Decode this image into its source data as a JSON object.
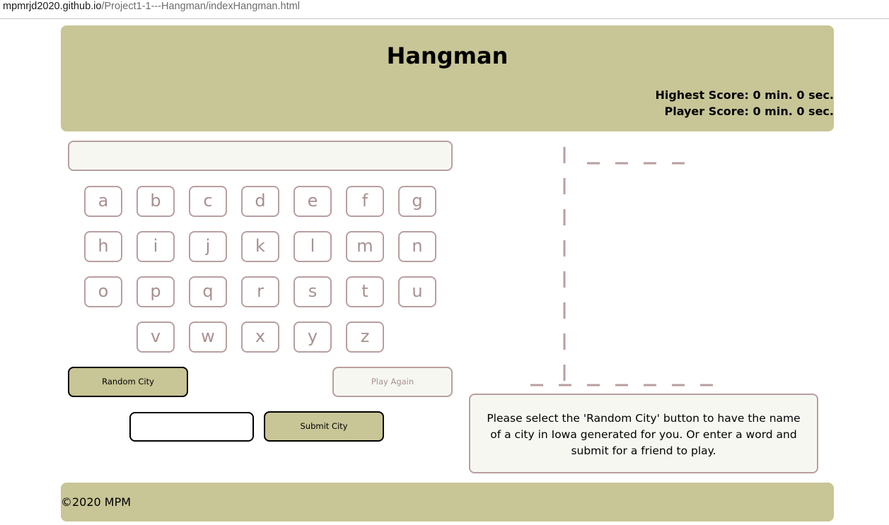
{
  "browser": {
    "url_host": "mpmrjd2020.github.io",
    "url_path": "/Project1-1---Hangman/indexHangman.html"
  },
  "header": {
    "title": "Hangman",
    "highest_score": "Highest Score: 0 min. 0 sec.",
    "player_score": "Player Score: 0 min. 0 sec."
  },
  "word_display": "",
  "keyboard": {
    "rows": [
      [
        "a",
        "b",
        "c",
        "d",
        "e",
        "f",
        "g"
      ],
      [
        "h",
        "i",
        "j",
        "k",
        "l",
        "m",
        "n"
      ],
      [
        "o",
        "p",
        "q",
        "r",
        "s",
        "t",
        "u"
      ],
      [
        "v",
        "w",
        "x",
        "y",
        "z"
      ]
    ]
  },
  "buttons": {
    "random_city": "Random City",
    "play_again": "Play Again",
    "submit_city": "Submit City"
  },
  "city_input": {
    "value": "",
    "placeholder": ""
  },
  "message": "Please select the 'Random City' button to have the name of a city in Iowa generated for you. Or enter a word and submit for a friend to play.",
  "footer": {
    "copyright": "©2020 MPM"
  },
  "colors": {
    "header_bg": "#c8c596",
    "border_muted": "#b89f9f",
    "text_muted": "#a89090",
    "panel_bg": "#f7f7f2"
  }
}
